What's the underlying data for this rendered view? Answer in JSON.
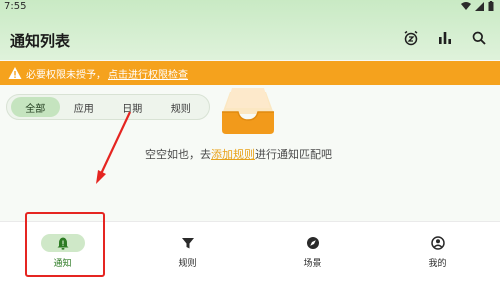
{
  "status_bar": {
    "time": "7:55"
  },
  "appbar": {
    "title": "通知列表",
    "actions": [
      {
        "name": "alarm-snooze-icon"
      },
      {
        "name": "bar-chart-icon"
      },
      {
        "name": "search-icon"
      }
    ]
  },
  "warning": {
    "text": "必要权限未授予，",
    "link": "点击进行权限检查",
    "color": "#f5a21d"
  },
  "filters": {
    "chips": [
      "全部",
      "应用",
      "日期",
      "规则"
    ],
    "selected": "全部"
  },
  "empty_state": {
    "prefix": "空空如也，去",
    "link": "添加规则",
    "suffix": "进行通知匹配吧"
  },
  "bottom_nav": {
    "items": [
      {
        "label": "通知",
        "icon": "notification-bell-icon",
        "active": true
      },
      {
        "label": "规则",
        "icon": "filter-icon",
        "active": false
      },
      {
        "label": "场景",
        "icon": "compass-icon",
        "active": false
      },
      {
        "label": "我的",
        "icon": "account-circle-icon",
        "active": false
      }
    ]
  },
  "colors": {
    "accent": "#2c7a23",
    "header": "#c9eac4",
    "warning": "#f5a21d",
    "highlight": "#e52521"
  }
}
